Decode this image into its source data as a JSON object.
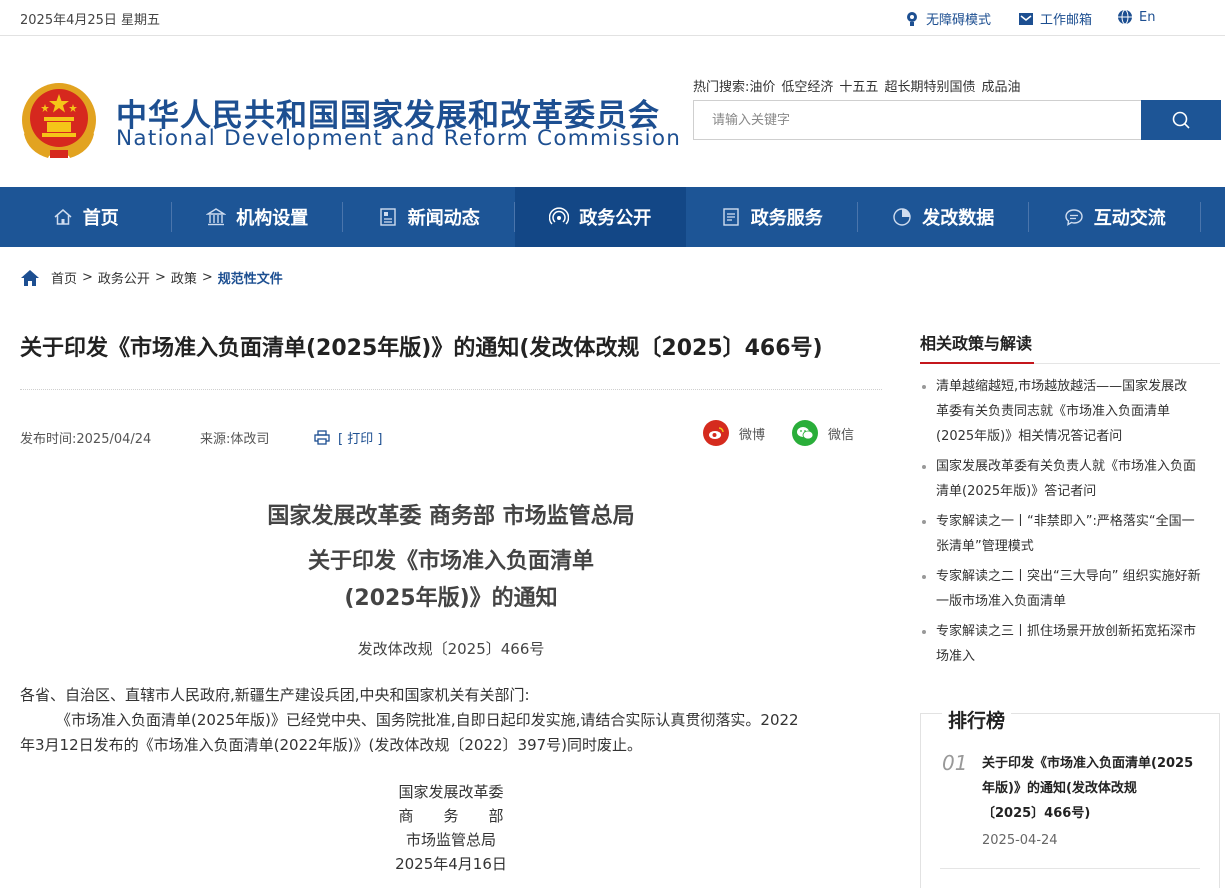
{
  "topbar": {
    "date": "2025年4月25日 星期五",
    "links": [
      {
        "label": "无障碍模式",
        "icon": "accessibility-icon"
      },
      {
        "label": "工作邮箱",
        "icon": "mail-icon"
      },
      {
        "label": "En",
        "icon": "globe-icon"
      }
    ]
  },
  "header": {
    "cn_name": "中华人民共和国国家发展和改革委员会",
    "en_name": "National Development and Reform Commission",
    "hot_label": "热门搜索:",
    "hot_items": [
      "油价",
      "低空经济",
      "十五五",
      "超长期特别国债",
      "成品油"
    ],
    "search_placeholder": "请输入关键字"
  },
  "nav": [
    {
      "label": "首页",
      "icon": "home-icon"
    },
    {
      "label": "机构设置",
      "icon": "building-icon"
    },
    {
      "label": "新闻动态",
      "icon": "news-icon"
    },
    {
      "label": "政务公开",
      "icon": "broadcast-icon",
      "active": true
    },
    {
      "label": "政务服务",
      "icon": "document-icon"
    },
    {
      "label": "发改数据",
      "icon": "pie-chart-icon"
    },
    {
      "label": "互动交流",
      "icon": "chat-icon"
    }
  ],
  "breadcrumb": {
    "items": [
      "首页",
      "政务公开",
      "政策"
    ],
    "current": "规范性文件",
    "sep": ">"
  },
  "article": {
    "title": "关于印发《市场准入负面清单(2025年版)》的通知(发改体改规〔2025〕466号)",
    "publish_time": "发布时间:2025/04/24",
    "source": "来源:体改司",
    "print_label": "[ 打印 ]",
    "share_weibo": "微博",
    "share_wechat": "微信",
    "issuers": "国家发展改革委 商务部 市场监管总局",
    "heading_line1": "关于印发《市场准入负面清单",
    "heading_line2": "(2025年版)》的通知",
    "doc_number": "发改体改规〔2025〕466号",
    "addressee": "各省、自治区、直辖市人民政府,新疆生产建设兵团,中央和国家机关有关部门:",
    "body_line1": "《市场准入负面清单(2025年版)》已经党中央、国务院批准,自即日起印发实施,请结合实际认真贯彻落实。2022",
    "body_line2": "年3月12日发布的《市场准入负面清单(2022年版)》(发改体改规〔2022〕397号)同时废止。",
    "sign1": "国家发展改革委",
    "sign2": "商　　务　　部",
    "sign3": "市场监管总局",
    "sign_date": "2025年4月16日"
  },
  "sidebar": {
    "related_title": "相关政策与解读",
    "related": [
      {
        "l1": "清单越缩越短,市场越放越活——国家发展改",
        "l2": "革委有关负责同志就《市场准入负面清单",
        "l3": "(2025年版)》相关情况答记者问"
      },
      {
        "l1": "国家发展改革委有关负责人就《市场准入负面",
        "l2": "清单(2025年版)》答记者问"
      },
      {
        "l1": "专家解读之一丨“非禁即入”:严格落实“全国一",
        "l2": "张清单”管理模式"
      },
      {
        "l1": "专家解读之二丨突出“三大导向” 组织实施好新",
        "l2": "一版市场准入负面清单"
      },
      {
        "l1": "专家解读之三丨抓住场景开放创新拓宽拓深市",
        "l2": "场准入"
      }
    ],
    "rank_title": "排行榜",
    "rank": [
      {
        "num": "01",
        "l1": "关于印发《市场准入负面清单(2025",
        "l2": "年版)》的通知(发改体改规",
        "l3": "〔2025〕466号)",
        "date": "2025-04-24"
      }
    ]
  },
  "colors": {
    "brand": "#1d5596",
    "nav_active": "#134786",
    "accent_red": "#c4161c",
    "weibo": "#d52b1e",
    "wechat": "#2aae3a"
  }
}
